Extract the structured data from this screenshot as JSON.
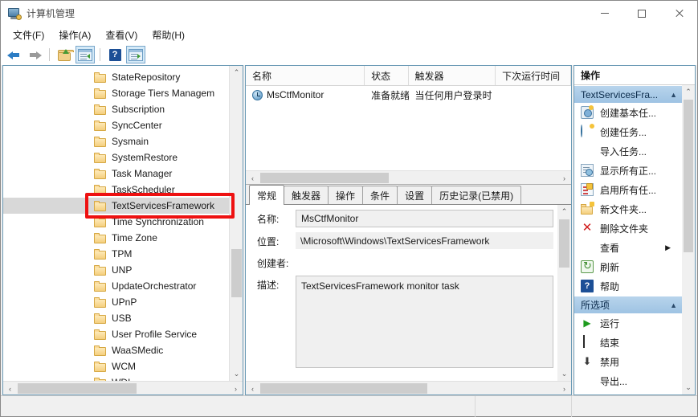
{
  "window": {
    "title": "计算机管理",
    "icon": "computer-management-icon",
    "controls": {
      "minimize": "–",
      "maximize": "□",
      "close": "✕"
    }
  },
  "menubar": {
    "items": [
      {
        "label": "文件(F)",
        "name": "menu-file"
      },
      {
        "label": "操作(A)",
        "name": "menu-action"
      },
      {
        "label": "查看(V)",
        "name": "menu-view"
      },
      {
        "label": "帮助(H)",
        "name": "menu-help"
      }
    ]
  },
  "toolbar": {
    "items": [
      {
        "name": "back-button",
        "icon": "back-arrow-icon"
      },
      {
        "name": "forward-button",
        "icon": "forward-arrow-icon"
      },
      {
        "name": "up-one-level-button",
        "icon": "folder-up-icon"
      },
      {
        "name": "show-hide-console-tree-button",
        "icon": "console-tree-icon"
      },
      {
        "name": "help-button",
        "icon": "help-icon"
      },
      {
        "name": "show-hide-action-pane-button",
        "icon": "action-pane-icon"
      }
    ]
  },
  "tree": {
    "items": [
      "StateRepository",
      "Storage Tiers Managem",
      "Subscription",
      "SyncCenter",
      "Sysmain",
      "SystemRestore",
      "Task Manager",
      "TaskScheduler",
      "TextServicesFramework",
      "Time Synchronization",
      "Time Zone",
      "TPM",
      "UNP",
      "UpdateOrchestrator",
      "UPnP",
      "USB",
      "User Profile Service",
      "WaaSMedic",
      "WCM",
      "WDI"
    ],
    "selected_index": 8,
    "highlight_color": "#ee1111",
    "scroll_up": "⌃",
    "scroll_down": "⌄",
    "scroll_left": "‹",
    "scroll_right": "›"
  },
  "tasklist": {
    "columns": [
      "名称",
      "状态",
      "触发器",
      "下次运行时间"
    ],
    "rows": [
      {
        "name": "MsCtfMonitor",
        "status": "准备就绪",
        "trigger": "当任何用户登录时",
        "next_run_time": "",
        "icon": "task-clock-icon"
      }
    ],
    "scroll_left": "‹",
    "scroll_right": "›"
  },
  "details": {
    "tabs": [
      {
        "label": "常规",
        "active": true
      },
      {
        "label": "触发器",
        "active": false
      },
      {
        "label": "操作",
        "active": false
      },
      {
        "label": "条件",
        "active": false
      },
      {
        "label": "设置",
        "active": false
      },
      {
        "label": "历史记录(已禁用)",
        "active": false
      }
    ],
    "fields": {
      "name_label": "名称:",
      "name_value": "MsCtfMonitor",
      "location_label": "位置:",
      "location_value": "\\Microsoft\\Windows\\TextServicesFramework",
      "author_label": "创建者:",
      "author_value": "",
      "description_label": "描述:",
      "description_value": "TextServicesFramework monitor task"
    },
    "scroll_up": "⌃",
    "scroll_down": "⌄",
    "scroll_left": "‹",
    "scroll_right": "›"
  },
  "actions": {
    "header": "操作",
    "groups": [
      {
        "title": "TextServicesFra...",
        "caret": "▲",
        "items": [
          {
            "label": "创建基本任...",
            "icon": "create-basic-task-icon",
            "type": "newbasic"
          },
          {
            "label": "创建任务...",
            "icon": "create-task-icon",
            "type": "newtask"
          },
          {
            "label": "导入任务...",
            "icon": "",
            "type": "none"
          },
          {
            "label": "显示所有正...",
            "icon": "display-all-running-tasks-icon",
            "type": "showall"
          },
          {
            "label": "启用所有任...",
            "icon": "enable-all-tasks-history-icon",
            "type": "enableall"
          },
          {
            "label": "新文件夹...",
            "icon": "new-folder-icon",
            "type": "newfolder"
          },
          {
            "label": "删除文件夹",
            "icon": "delete-folder-icon",
            "type": "delete"
          },
          {
            "label": "查看",
            "icon": "",
            "type": "none",
            "submenu": "▶"
          },
          {
            "label": "刷新",
            "icon": "refresh-icon",
            "type": "refresh"
          },
          {
            "label": "帮助",
            "icon": "help-icon",
            "type": "help"
          }
        ]
      },
      {
        "title": "所选项",
        "caret": "▲",
        "items": [
          {
            "label": "运行",
            "icon": "run-icon",
            "type": "run"
          },
          {
            "label": "结束",
            "icon": "end-icon",
            "type": "end"
          },
          {
            "label": "禁用",
            "icon": "disable-icon",
            "type": "disable"
          },
          {
            "label": "导出...",
            "icon": "",
            "type": "none"
          }
        ]
      }
    ],
    "scroll_up": "⌃",
    "scroll_down": "⌄"
  },
  "statusbar": {
    "cells": [
      "",
      "",
      ""
    ]
  }
}
